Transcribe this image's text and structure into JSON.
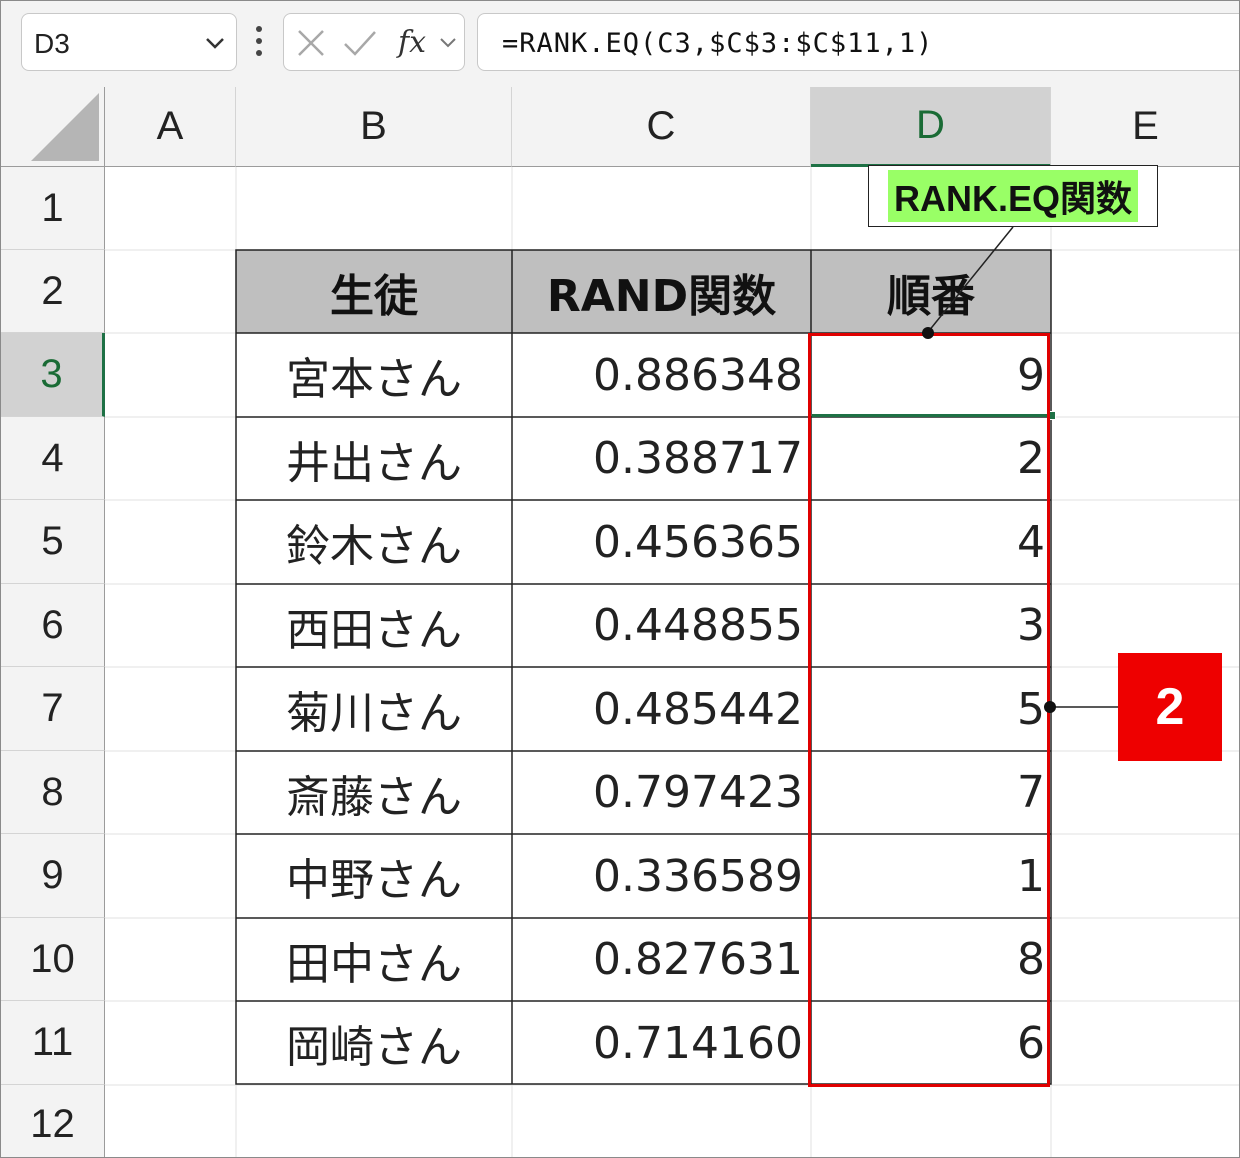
{
  "formula_bar": {
    "name_box": "D3",
    "formula": "=RANK.EQ(C3,$C$3:$C$11,1)"
  },
  "columns": [
    "A",
    "B",
    "C",
    "D",
    "E"
  ],
  "selected_column": "D",
  "rows": [
    "1",
    "2",
    "3",
    "4",
    "5",
    "6",
    "7",
    "8",
    "9",
    "10",
    "11",
    "12"
  ],
  "selected_row": "3",
  "table": {
    "headers": [
      "生徒",
      "RAND関数",
      "順番"
    ],
    "rows": [
      {
        "name": "宮本さん",
        "rand": "0.886348",
        "rank": "9"
      },
      {
        "name": "井出さん",
        "rand": "0.388717",
        "rank": "2"
      },
      {
        "name": "鈴木さん",
        "rand": "0.456365",
        "rank": "4"
      },
      {
        "name": "西田さん",
        "rand": "0.448855",
        "rank": "3"
      },
      {
        "name": "菊川さん",
        "rand": "0.485442",
        "rank": "5"
      },
      {
        "name": "斎藤さん",
        "rand": "0.797423",
        "rank": "7"
      },
      {
        "name": "中野さん",
        "rand": "0.336589",
        "rank": "1"
      },
      {
        "name": "田中さん",
        "rand": "0.827631",
        "rank": "8"
      },
      {
        "name": "岡崎さん",
        "rand": "0.714160",
        "rank": "6"
      }
    ]
  },
  "annotations": {
    "callout": "RANK.EQ関数",
    "badge": "2",
    "callout_highlight_color": "#99ff66",
    "box_color": "#e00000",
    "badge_color": "#ee0000"
  },
  "icons": {
    "dropdown": "chevron-down-icon",
    "more": "vertical-dots-icon",
    "cancel": "cross-icon",
    "enter": "check-icon",
    "function": "fx-icon"
  }
}
